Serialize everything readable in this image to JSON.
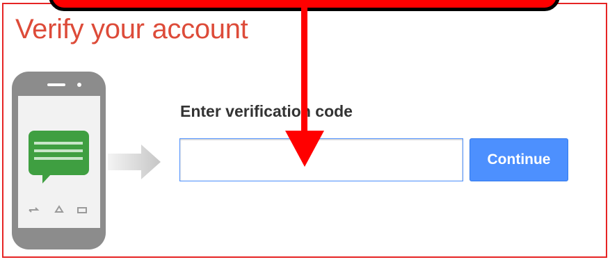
{
  "header": {
    "title": "Verify your account"
  },
  "form": {
    "code_label": "Enter verification code",
    "code_value": "",
    "continue_label": "Continue"
  },
  "colors": {
    "title": "#dd4b39",
    "frame_border": "#e62424",
    "button": "#4d90fe",
    "annotation": "#ff0000"
  },
  "icons": {
    "phone": "smartphone-icon",
    "message": "chat-bubble-icon",
    "arrow": "right-arrow-icon",
    "annotation_arrow": "down-arrow-icon"
  }
}
